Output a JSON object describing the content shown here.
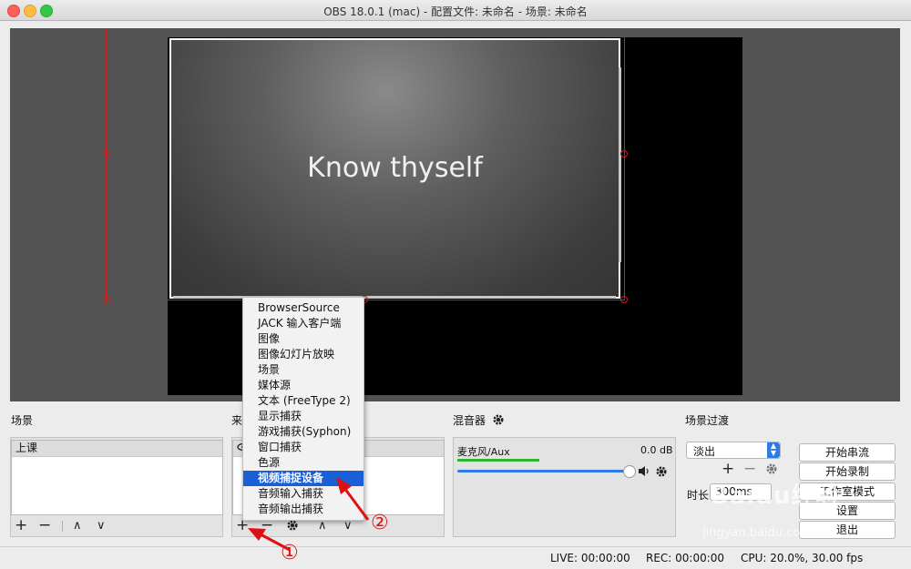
{
  "window": {
    "title": "OBS 18.0.1 (mac) - 配置文件: 未命名 - 场景: 未命名"
  },
  "preview": {
    "text": "Know thyself"
  },
  "scenes": {
    "header": "场景",
    "items": [
      "上课"
    ]
  },
  "sources": {
    "header": "来"
  },
  "toolbar": {
    "add": "+",
    "remove": "−",
    "up": "∧",
    "down": "∨",
    "settings_icon": "gear-icon"
  },
  "add_source_menu": {
    "items": [
      "BrowserSource",
      "JACK 输入客户端",
      "图像",
      "图像幻灯片放映",
      "场景",
      "媒体源",
      "文本 (FreeType 2)",
      "显示捕获",
      "游戏捕获(Syphon)",
      "窗口捕获",
      "色源",
      "视频捕捉设备",
      "音频输入捕获",
      "音频输出捕获"
    ],
    "highlighted": "视频捕捉设备"
  },
  "mixer": {
    "header": "混音器",
    "channel": "麦克风/Aux",
    "level": "0.0 dB",
    "volume": 0.97
  },
  "transitions": {
    "header": "场景过渡",
    "selected": "淡出",
    "duration_label": "时长",
    "duration": "300ms"
  },
  "controls": {
    "start_stream": "开始串流",
    "start_record": "开始录制",
    "studio_mode": "工作室模式",
    "settings": "设置",
    "exit": "退出"
  },
  "status": {
    "live": "LIVE: 00:00:00",
    "rec": "REC: 00:00:00",
    "cpu": "CPU: 20.0%, 30.00 fps"
  },
  "annotations": {
    "one": "①",
    "two": "②"
  },
  "watermark": {
    "brand": "Baidu经验",
    "url": "jingyan.baidu.com"
  },
  "colors": {
    "selection": "#d31d1d",
    "highlight": "#1a5fd6",
    "annotation": "#e01010"
  }
}
